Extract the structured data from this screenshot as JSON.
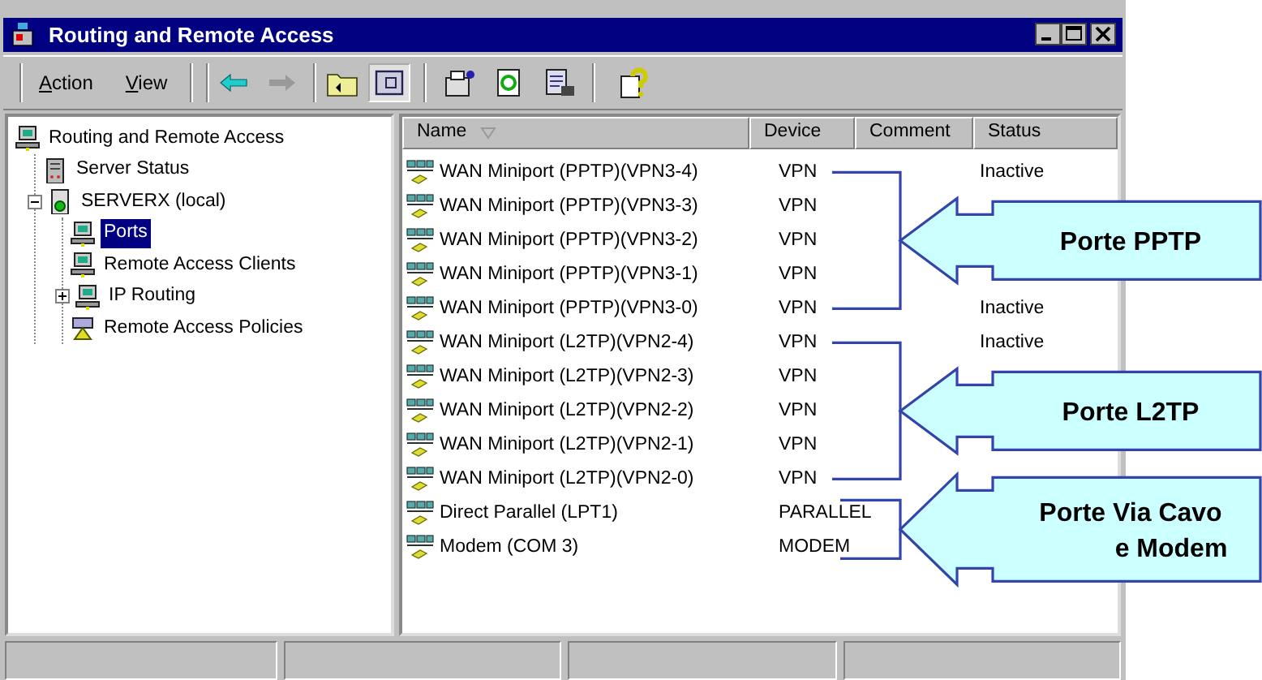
{
  "window": {
    "title": "Routing and Remote Access"
  },
  "menu": [
    {
      "label": "Action"
    },
    {
      "label": "View"
    }
  ],
  "tree": [
    {
      "label": "Routing and Remote Access",
      "selected": false,
      "children": [
        {
          "label": "Server Status",
          "selected": false
        },
        {
          "label": "SERVERX (local)",
          "selected": false,
          "expanded": true,
          "children": [
            {
              "label": "Ports",
              "selected": true
            },
            {
              "label": "Remote Access Clients",
              "selected": false
            },
            {
              "label": "IP Routing",
              "selected": false,
              "expanded": false
            },
            {
              "label": "Remote Access Policies",
              "selected": false
            }
          ]
        }
      ]
    }
  ],
  "table": {
    "columns": [
      "Name",
      "Device",
      "Comment",
      "Status"
    ],
    "rows": [
      {
        "name": "WAN Miniport (PPTP)(VPN3-4)",
        "device": "VPN",
        "status": "Inactive"
      },
      {
        "name": "WAN Miniport (PPTP)(VPN3-3)",
        "device": "VPN"
      },
      {
        "name": "WAN Miniport (PPTP)(VPN3-2)",
        "device": "VPN"
      },
      {
        "name": "WAN Miniport (PPTP)(VPN3-1)",
        "device": "VPN"
      },
      {
        "name": "WAN Miniport (PPTP)(VPN3-0)",
        "device": "VPN",
        "status": "Inactive"
      },
      {
        "name": "WAN Miniport (L2TP)(VPN2-4)",
        "device": "VPN",
        "status": "Inactive"
      },
      {
        "name": "WAN Miniport (L2TP)(VPN2-3)",
        "device": "VPN"
      },
      {
        "name": "WAN Miniport (L2TP)(VPN2-2)",
        "device": "VPN"
      },
      {
        "name": "WAN Miniport (L2TP)(VPN2-1)",
        "device": "VPN"
      },
      {
        "name": "WAN Miniport (L2TP)(VPN2-0)",
        "device": "VPN"
      },
      {
        "name": "Direct Parallel (LPT1)",
        "device": "PARALLEL"
      },
      {
        "name": "Modem (COM 3)",
        "device": "MODEM"
      }
    ]
  },
  "callouts": [
    {
      "lines": [
        "Porte PPTP"
      ]
    },
    {
      "lines": [
        "Porte L2TP"
      ]
    },
    {
      "lines": [
        "Porte Via Cavo",
        "e Modem"
      ]
    }
  ]
}
